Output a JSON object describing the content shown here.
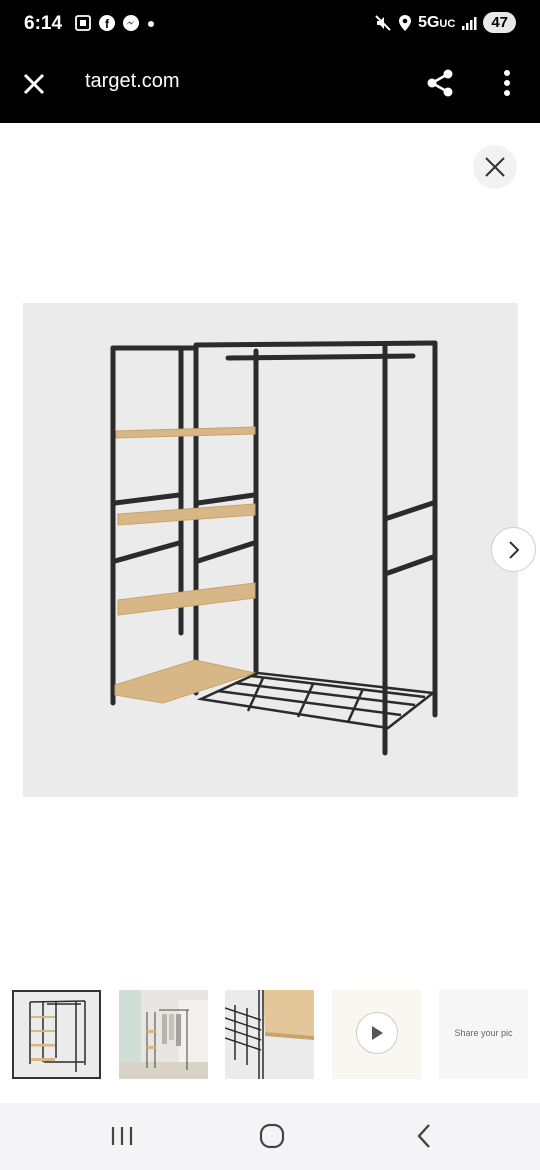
{
  "status_bar": {
    "time": "6:14",
    "network": "5G",
    "network_suffix": "UC",
    "battery": "47"
  },
  "browser": {
    "url": "target.com"
  },
  "thumbnails": {
    "share_label": "Share your pic"
  },
  "colors": {
    "frame": "#2b2b2b",
    "shelf": "#d8b787",
    "background": "#ebebec"
  }
}
